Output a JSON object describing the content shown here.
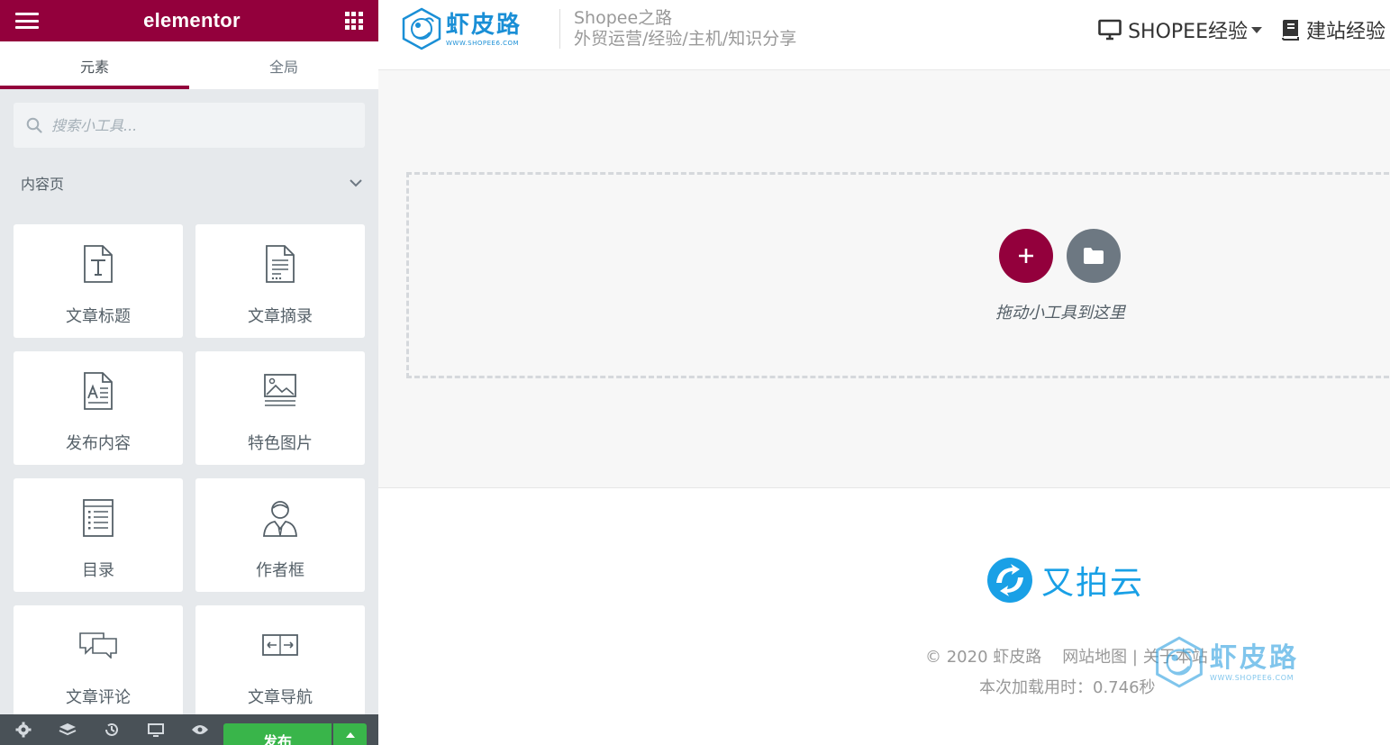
{
  "editor": {
    "brand": "elementor",
    "tabs": [
      {
        "label": "元素",
        "active": true
      },
      {
        "label": "全局",
        "active": false
      }
    ],
    "search": {
      "placeholder": "搜索小工具..."
    },
    "category": {
      "label": "内容页",
      "expanded": true
    },
    "widgets": [
      {
        "label": "文章标题",
        "icon": "post-title-icon"
      },
      {
        "label": "文章摘录",
        "icon": "post-excerpt-icon"
      },
      {
        "label": "发布内容",
        "icon": "post-content-icon"
      },
      {
        "label": "特色图片",
        "icon": "featured-image-icon"
      },
      {
        "label": "目录",
        "icon": "table-of-contents-icon"
      },
      {
        "label": "作者框",
        "icon": "author-box-icon"
      },
      {
        "label": "文章评论",
        "icon": "post-comments-icon"
      },
      {
        "label": "文章导航",
        "icon": "post-navigation-icon"
      }
    ],
    "footer": {
      "publish_label": "发布",
      "icons": [
        "settings-icon",
        "navigator-icon",
        "history-icon",
        "responsive-icon",
        "preview-icon"
      ]
    },
    "accent": "#93003c",
    "publish_color": "#39b54a"
  },
  "site": {
    "logo_text": "虾皮路",
    "logo_url": "WWW.SHOPEE6.COM",
    "tagline_line1": "Shopee之路",
    "tagline_line2": "外贸运营/经验/主机/知识分享",
    "nav": [
      {
        "label": "SHOPEE经验",
        "icon": "monitor-icon",
        "dropdown": true
      },
      {
        "label": "建站经验",
        "icon": "book-icon",
        "dropdown": false
      }
    ],
    "logo_color": "#1a8fd6"
  },
  "canvas": {
    "drop_text": "拖动小工具到这里"
  },
  "footer": {
    "sponsor": "又拍云",
    "copyright": "© 2020 虾皮路",
    "links": [
      "网站地图",
      "关于本站"
    ],
    "separator": "|",
    "load_time": "本次加载用时：0.746秒",
    "sponsor_color": "#19a0e6"
  },
  "watermark": {
    "text": "虾皮路",
    "url": "WWW.SHOPEE6.COM"
  }
}
